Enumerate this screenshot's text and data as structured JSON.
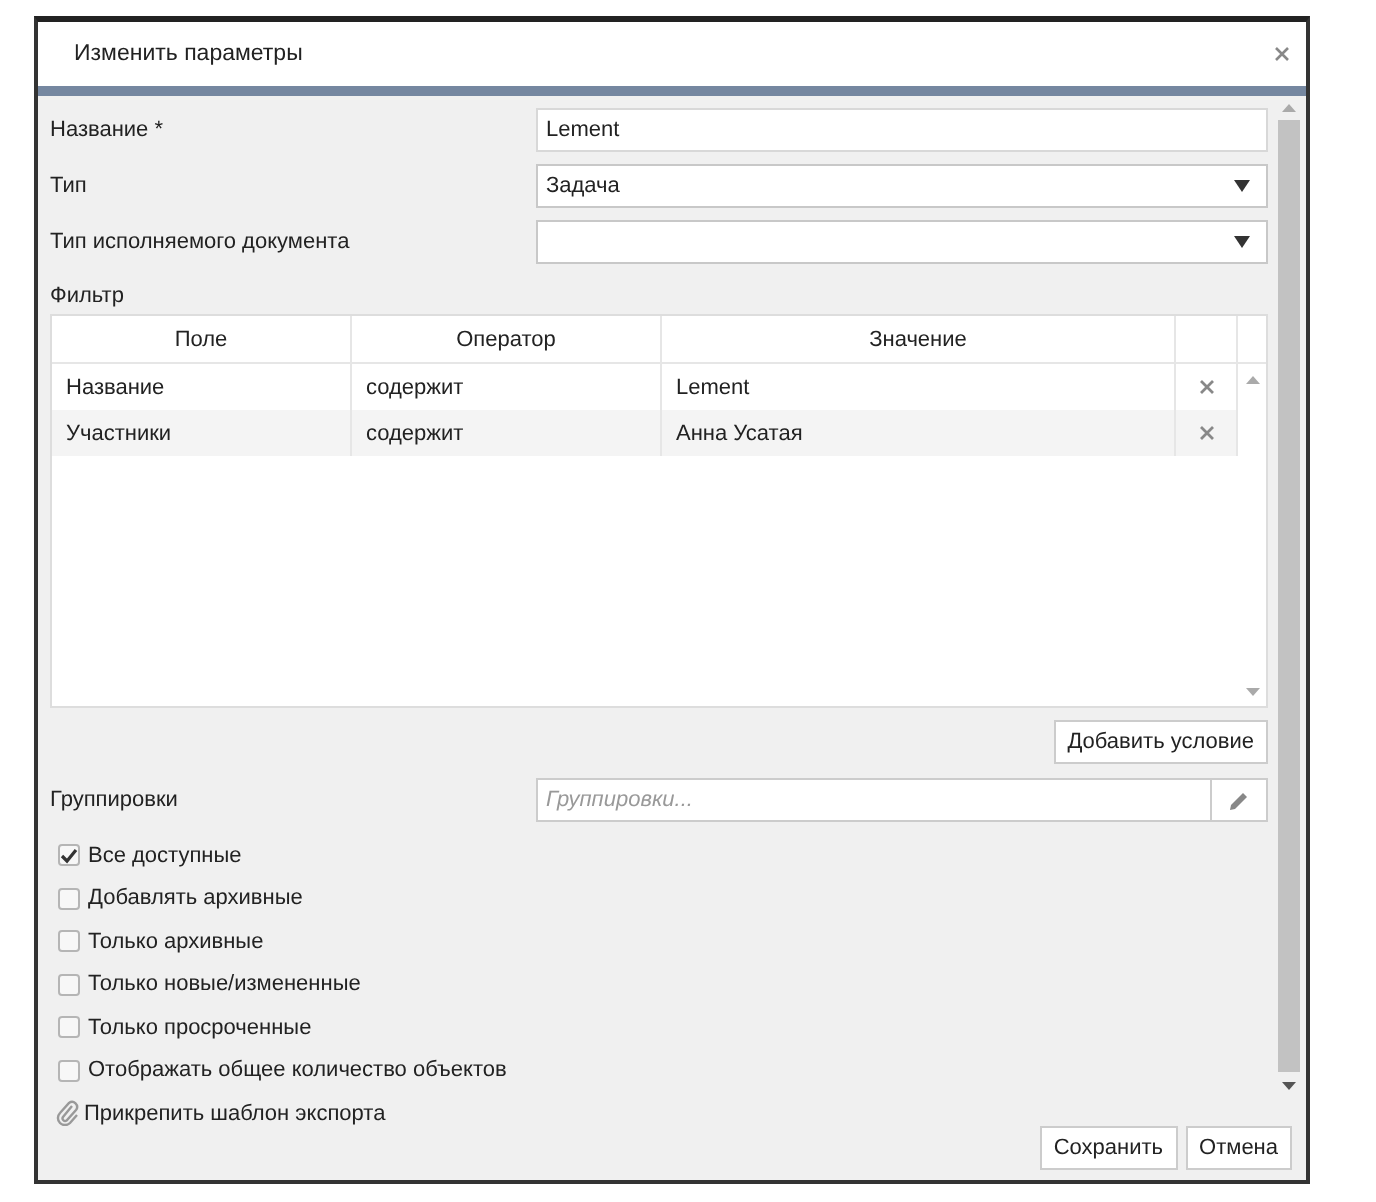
{
  "window": {
    "title": "Изменить параметры"
  },
  "fields": [
    {
      "kind": "text",
      "label": "Название *",
      "value": "Lement"
    },
    {
      "kind": "select",
      "label": "Тип",
      "value": "Задача"
    },
    {
      "kind": "select",
      "label": "Тип исполняемого документа"
    }
  ],
  "filter": {
    "label": "Фильтр",
    "columns": [
      "Поле",
      "Оператор",
      "Значение"
    ],
    "rows": [
      {
        "field": "Название",
        "operator": "содержит",
        "value": "Lement"
      },
      {
        "field": "Участники",
        "operator": "содержит",
        "value": "Анна Усатая"
      }
    ],
    "add_button": "Добавить условие"
  },
  "groupings": {
    "label": "Группировки",
    "placeholder": "Группировки..."
  },
  "options": [
    {
      "label": "Все доступные",
      "checked": true
    },
    {
      "label": "Добавлять архивные",
      "checked": false
    },
    {
      "label": "Только архивные",
      "checked": false
    },
    {
      "label": "Только новые/измененные",
      "checked": false
    },
    {
      "label": "Только просроченные",
      "checked": false
    },
    {
      "label": "Отображать общее количество объектов",
      "checked": false
    }
  ],
  "attach_link": "Прикрепить шаблон экспорта",
  "buttons": [
    "Сохранить",
    "Отмена"
  ]
}
